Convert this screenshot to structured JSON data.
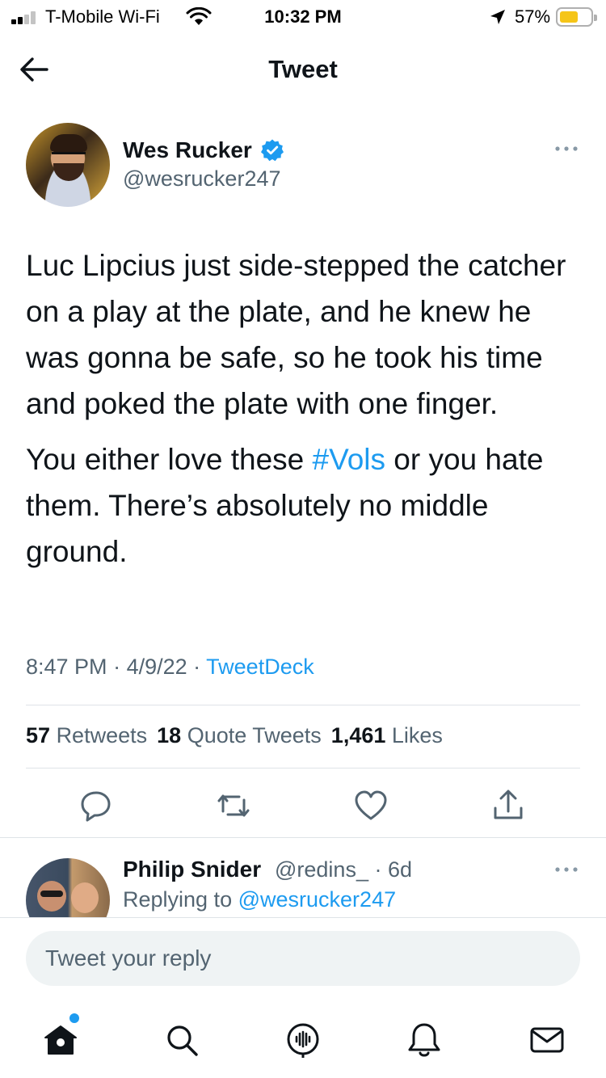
{
  "status_bar": {
    "carrier": "T-Mobile Wi-Fi",
    "time": "10:32 PM",
    "battery_percent": "57%",
    "battery_level": 0.57,
    "battery_color": "#f5c518",
    "signal_bars_filled": 2,
    "icons": [
      "signal-icon",
      "wifi-icon",
      "location-arrow-icon",
      "battery-icon"
    ]
  },
  "header": {
    "title": "Tweet",
    "back_icon": "arrow-left-icon"
  },
  "tweet": {
    "author_name": "Wes Rucker",
    "author_handle": "@wesrucker247",
    "verified": true,
    "text_p1": "Luc Lipcius just side-stepped the catcher on a play at the plate, and he knew he was gonna be safe, so he took his time and poked the plate with one finger.",
    "text_p2_before": "You either love these ",
    "hashtag": "#Vols",
    "text_p2_after": " or you hate them. There’s absolutely no middle ground.",
    "time": "8:47 PM",
    "date": "4/9/22",
    "source": "TweetDeck",
    "retweets_count": "57",
    "retweets_label": "Retweets",
    "quotes_count": "18",
    "quotes_label": "Quote Tweets",
    "likes_count": "1,461",
    "likes_label": "Likes",
    "actions": [
      "reply-icon",
      "retweet-icon",
      "like-icon",
      "share-icon"
    ]
  },
  "reply": {
    "author_name": "Philip Snider",
    "handle_time": "@redins_ · 6d",
    "replying_prefix": "Replying to",
    "replying_to": "@wesrucker247"
  },
  "composer": {
    "placeholder": "Tweet your reply"
  },
  "tabbar": {
    "items": [
      "home-icon",
      "search-icon",
      "spaces-icon",
      "notifications-icon",
      "messages-icon"
    ],
    "active": "home-icon"
  },
  "colors": {
    "accent": "#1d9bf0",
    "text": "#0f1419",
    "secondary": "#536471",
    "divider": "#dfe3e7"
  }
}
